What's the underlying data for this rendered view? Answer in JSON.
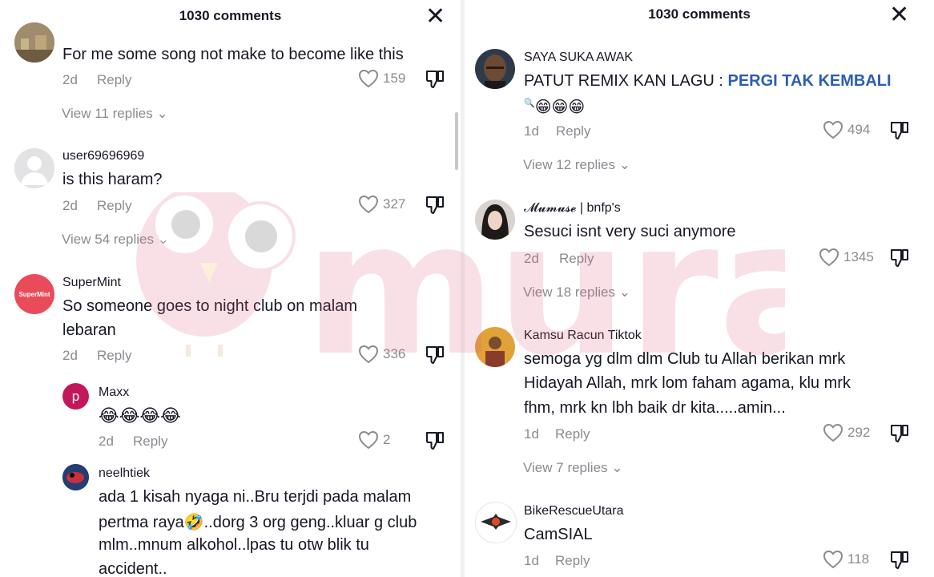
{
  "left": {
    "title": "1030 comments",
    "close_glyph": "✕",
    "comments": [
      {
        "user": "",
        "text": "For me some song not make to become like this",
        "date": "2d",
        "reply": "Reply",
        "likes": "159",
        "view_replies": "View 11 replies"
      },
      {
        "user": "user69696969",
        "text": "is this haram?",
        "date": "2d",
        "reply": "Reply",
        "likes": "327",
        "view_replies": "View 54 replies"
      },
      {
        "user": "SuperMint",
        "avatar_text": "SuperMint",
        "text1": "So someone goes to night club on malam",
        "text2": "lebaran",
        "date": "2d",
        "reply": "Reply",
        "likes": "336"
      }
    ],
    "replies": [
      {
        "user": "Maxx",
        "avatar_letter": "p",
        "text": "😂😂😂😂",
        "date": "2d",
        "reply": "Reply",
        "likes": "2"
      },
      {
        "user": "neelhtiek",
        "line1": "ada 1 kisah nyaga ni..Bru terjdi pada malam",
        "line2": "pertma raya🤣..dorg 3 org geng..kluar g club",
        "line3": "mlm..mnum alkohol..lpas tu otw blik tu",
        "line4": "accident.."
      }
    ]
  },
  "right": {
    "title": "1030 comments",
    "close_glyph": "✕",
    "comments": [
      {
        "user": "SAYA SUKA AWAK",
        "text_prefix": "PATUT REMIX KAN LAGU : ",
        "text_link": "PERGI TAK KEMBALI",
        "text_line2": "😁😁😁",
        "date": "1d",
        "reply": "Reply",
        "likes": "494",
        "view_replies": "View 12 replies"
      },
      {
        "user": "𝓜𝓾𝓶𝓾𝓼𝓮 | bnfp's",
        "text": "Sesuci isnt very suci anymore",
        "date": "2d",
        "reply": "Reply",
        "likes": "1345",
        "view_replies": "View 18 replies"
      },
      {
        "user": "Kamsu Racun Tiktok",
        "line1": "semoga yg dlm dlm Club tu Allah berikan mrk",
        "line2": "Hidayah Allah, mrk lom faham agama, klu mrk",
        "line3": "fhm, mrk kn lbh baik dr kita.....amin...",
        "date": "1d",
        "reply": "Reply",
        "likes": "292",
        "view_replies": "View 7 replies"
      },
      {
        "user": "BikeRescueUtara",
        "text": "CamSIAL",
        "date": "1d",
        "reply": "Reply",
        "likes": "118"
      }
    ]
  },
  "watermark": "murai",
  "colors": {
    "meta": "#8a8b91",
    "link": "#2b5db5",
    "supermint": "#e84c5b",
    "maxx": "#c2185b"
  }
}
